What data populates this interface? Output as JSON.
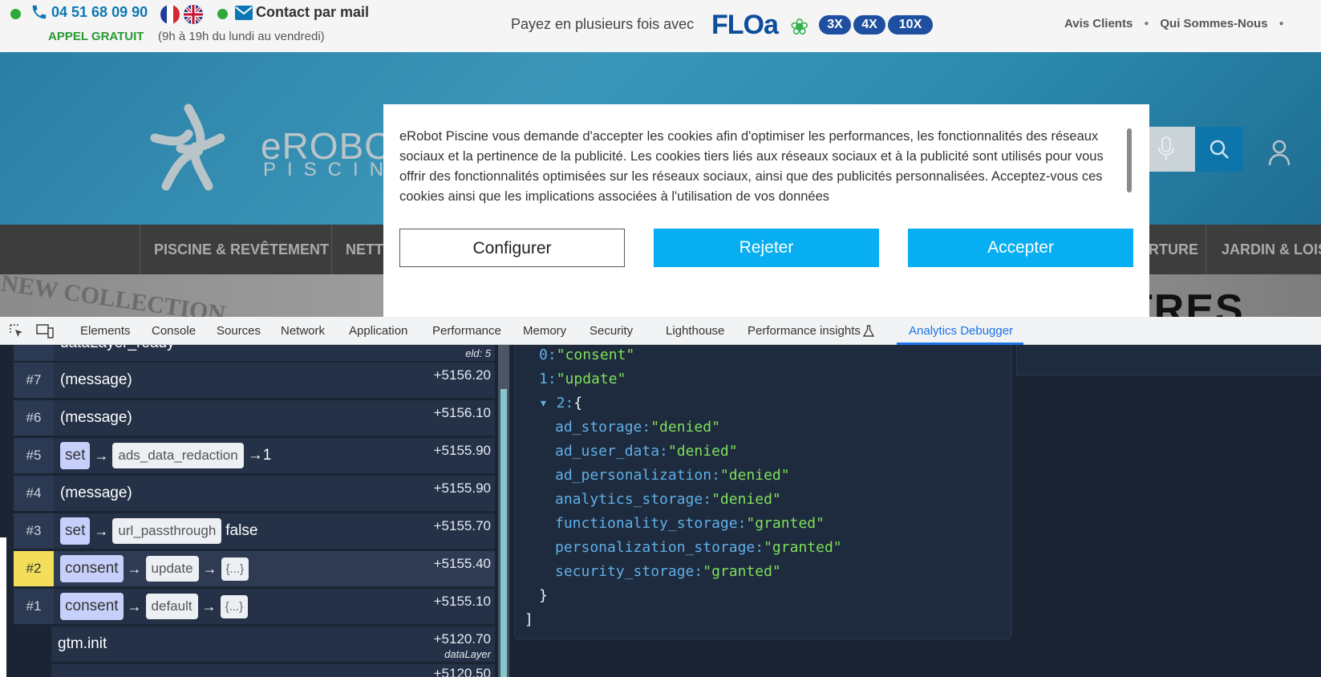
{
  "topbar": {
    "phone": "04 51 68 09 90",
    "contact": "Contact par mail",
    "appel": "APPEL GRATUIT",
    "hours": "(9h à 19h du lundi au vendredi)",
    "floa_text": "Payez en plusieurs fois avec",
    "floa_logo": "FLOa",
    "floa_options": [
      "3X",
      "4X",
      "10X"
    ],
    "links": [
      "Avis Clients",
      "Qui Sommes-Nous"
    ]
  },
  "hero": {
    "logo_name": "eROBOT",
    "logo_sub": "PISCINE"
  },
  "nav": {
    "items": [
      "PISCINE & REVÊTEMENT",
      "NETTO",
      "ERTURE",
      "JARDIN & LOIS"
    ]
  },
  "banner": {
    "left_text": "NEW COLLECTION",
    "right_text": "TRES NOU"
  },
  "cookie": {
    "text": "eRobot Piscine vous demande d'accepter les cookies afin d'optimiser les performances, les fonctionnalités des réseaux sociaux et la pertinence de la publicité. Les cookies tiers liés aux réseaux sociaux et à la publicité sont utilisés pour vous offrir des fonctionnalités optimisées sur les réseaux sociaux, ainsi que des publicités personnalisées. Acceptez-vous ces cookies ainsi que les implications associées à l'utilisation de vos données",
    "configure": "Configurer",
    "reject": "Rejeter",
    "accept": "Accepter"
  },
  "devtools": {
    "tabs": [
      "Elements",
      "Console",
      "Sources",
      "Network",
      "Application",
      "Performance",
      "Memory",
      "Security",
      "Lighthouse",
      "Performance insights",
      "Analytics Debugger"
    ],
    "active_tab": "Analytics Debugger"
  },
  "events": {
    "top_partial": {
      "label": "dataLayer_ready",
      "sub": "eld: 5"
    },
    "rows": [
      {
        "num": "#7",
        "label": "(message)",
        "time": "+5156.20"
      },
      {
        "num": "#6",
        "label": "(message)",
        "time": "+5156.10"
      },
      {
        "num": "#5",
        "cmd": "set",
        "key": "ads_data_redaction",
        "value": "→1",
        "time": "+5155.90"
      },
      {
        "num": "#4",
        "label": "(message)",
        "time": "+5155.90"
      },
      {
        "num": "#3",
        "cmd": "set",
        "key": "url_passthrough",
        "value": "false",
        "time": "+5155.70"
      },
      {
        "num": "#2",
        "cmd": "consent",
        "key": "update",
        "value": "{...}",
        "time": "+5155.40"
      },
      {
        "num": "#1",
        "cmd": "consent",
        "key": "default",
        "value": "{...}",
        "time": "+5155.10"
      },
      {
        "label": "gtm.init",
        "time": "+5120.70",
        "sub": "dataLayer"
      },
      {
        "time": "+5120.50"
      }
    ]
  },
  "json_view": {
    "items": [
      {
        "k": "0:",
        "v": "\"consent\""
      },
      {
        "k": "1:",
        "v": "\"update\""
      },
      {
        "k": "▾ 2:",
        "v": "{"
      }
    ],
    "props": [
      {
        "k": "ad_storage:",
        "v": "\"denied\""
      },
      {
        "k": "ad_user_data:",
        "v": "\"denied\""
      },
      {
        "k": "ad_personalization:",
        "v": "\"denied\""
      },
      {
        "k": "analytics_storage:",
        "v": "\"denied\""
      },
      {
        "k": "functionality_storage:",
        "v": "\"granted\""
      },
      {
        "k": "personalization_storage:",
        "v": "\"granted\""
      },
      {
        "k": "security_storage:",
        "v": "\"granted\""
      }
    ],
    "close_brace": "}",
    "close_bracket": "]"
  },
  "colors": {
    "accent_blue": "#08aef2",
    "devtools_active": "#1a73e8",
    "json_key": "#5fb0e8",
    "json_string": "#7ee05a",
    "highlight": "#f2de5a"
  }
}
